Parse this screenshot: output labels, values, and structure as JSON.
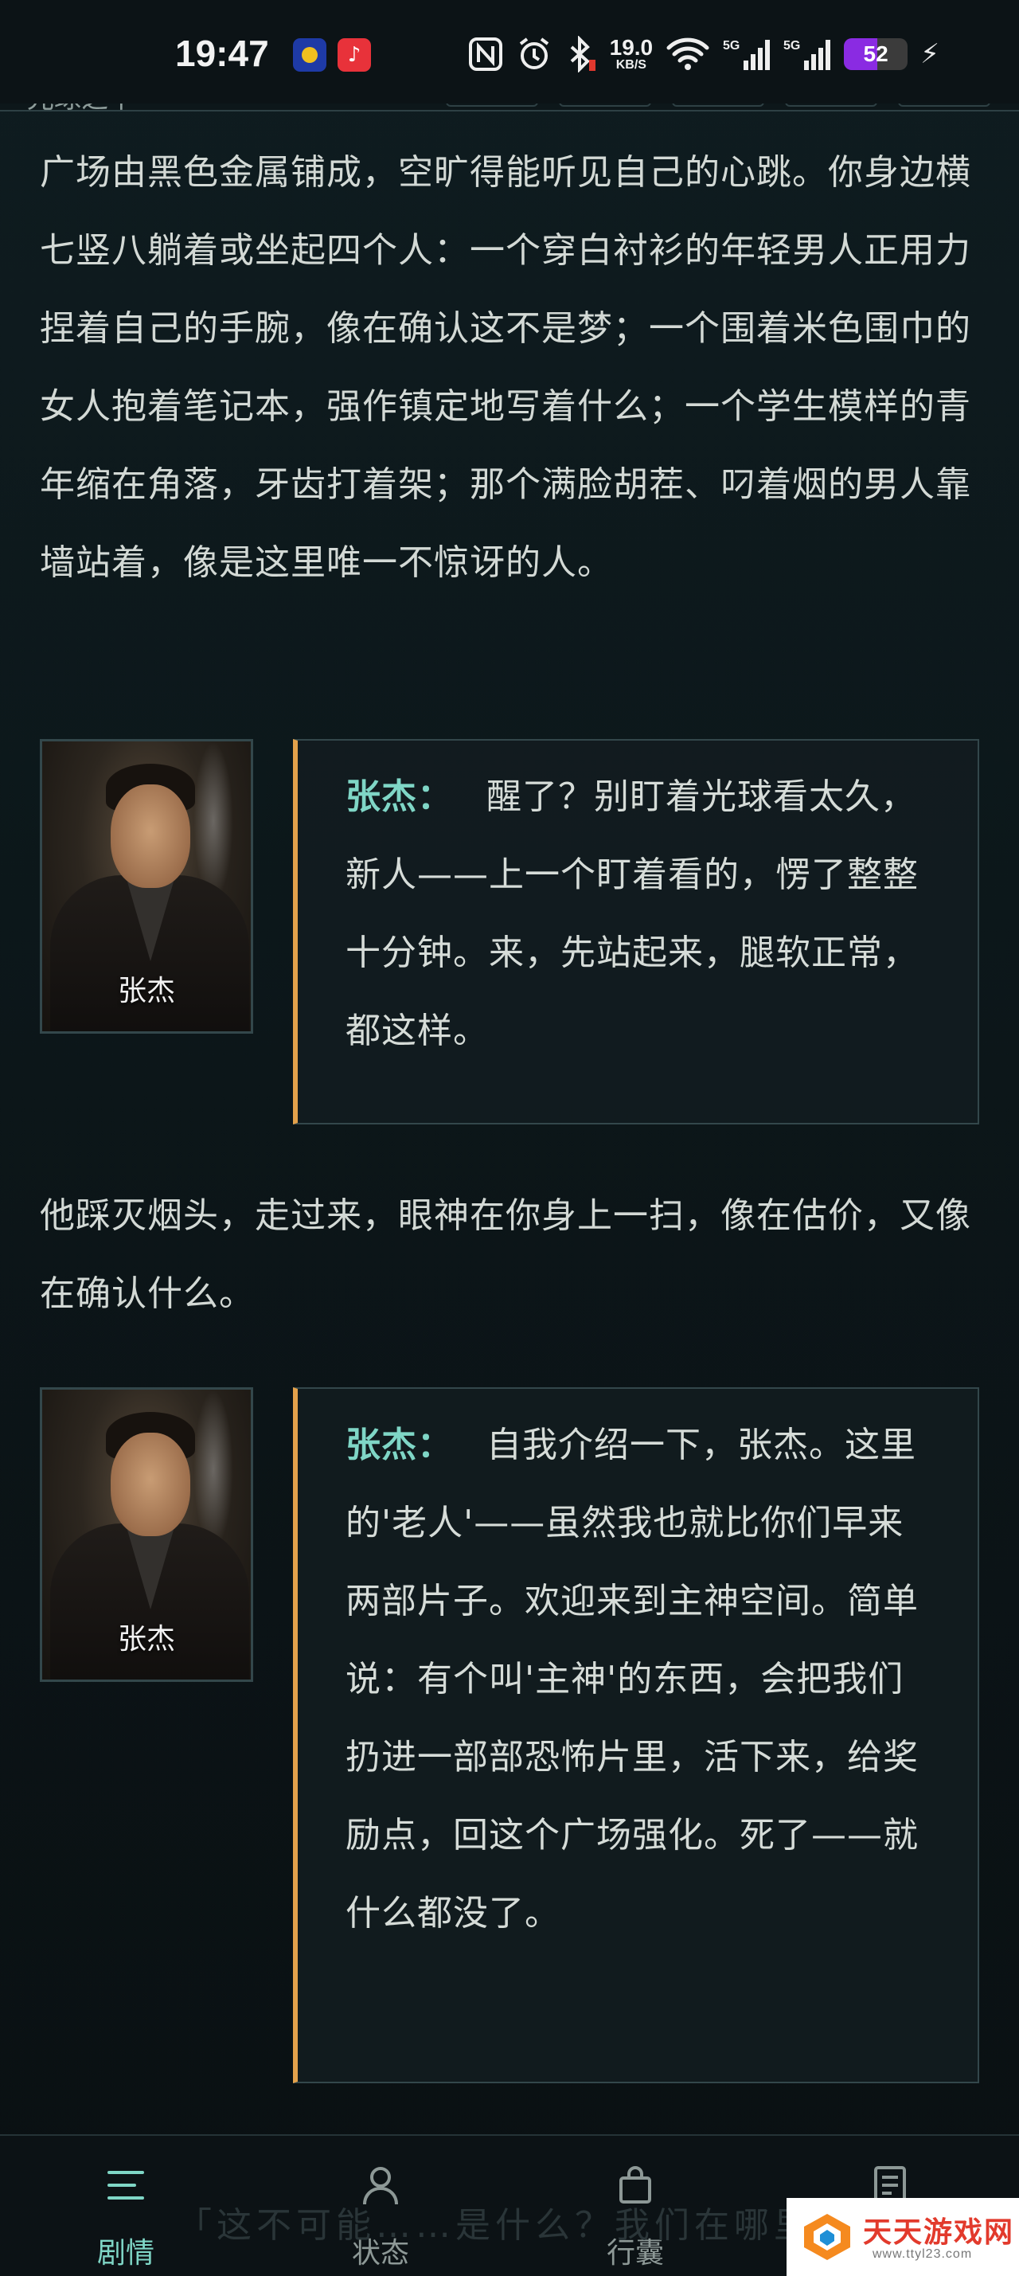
{
  "status_bar": {
    "time": "19:47",
    "net_speed_value": "19.0",
    "net_speed_unit": "KB/S",
    "signal1_label": "5G",
    "signal2_label": "5G",
    "battery": "52",
    "icons": [
      "nfc-icon",
      "alarm-icon",
      "bluetooth-icon",
      "wifi-icon",
      "signal-icon",
      "charging-icon"
    ]
  },
  "header": {
    "title": "光球之下"
  },
  "story": {
    "para1": "广场由黑色金属铺成，空旷得能听见自己的心跳。你身边横七竖八躺着或坐起四个人：一个穿白衬衫的年轻男人正用力捏着自己的手腕，像在确认这不是梦；一个围着米色围巾的女人抱着笔记本，强作镇定地写着什么；一个学生模样的青年缩在角落，牙齿打着架；那个满脸胡茬、叼着烟的男人靠墙站着，像是这里唯一不惊讶的人。",
    "dialogue1": {
      "avatar_name": "张杰",
      "speaker": "张杰：",
      "text": "醒了？别盯着光球看太久，新人——上一个盯着看的，愣了整整十分钟。来，先站起来，腿软正常，都这样。"
    },
    "para2": "他踩灭烟头，走过来，眼神在你身上一扫，像在估价，又像在确认什么。",
    "dialogue2": {
      "avatar_name": "张杰",
      "speaker": "张杰：",
      "text": "自我介绍一下，张杰。这里的'老人'——虽然我也就比你们早来两部片子。欢迎来到主神空间。简单说：有个叫'主神'的东西，会把我们扔进一部部恐怖片里，活下来，给奖励点，回这个广场强化。死了——就什么都没了。"
    }
  },
  "bottom_nav": {
    "items": [
      {
        "label": "剧情",
        "icon": "menu-lines-icon",
        "active": true
      },
      {
        "label": "状态",
        "icon": "person-icon",
        "active": false
      },
      {
        "label": "行囊",
        "icon": "bag-icon",
        "active": false
      },
      {
        "label": "",
        "icon": "document-icon",
        "active": false
      }
    ],
    "ghost_text": "「这不可能……是什么？我们在哪里？"
  },
  "watermark": {
    "title": "天天游戏网",
    "url": "www.ttyl23.com"
  },
  "colors": {
    "accent": "#7fd6c6",
    "bubble_border_left": "#e3a14b",
    "background": "#0f1c20"
  }
}
